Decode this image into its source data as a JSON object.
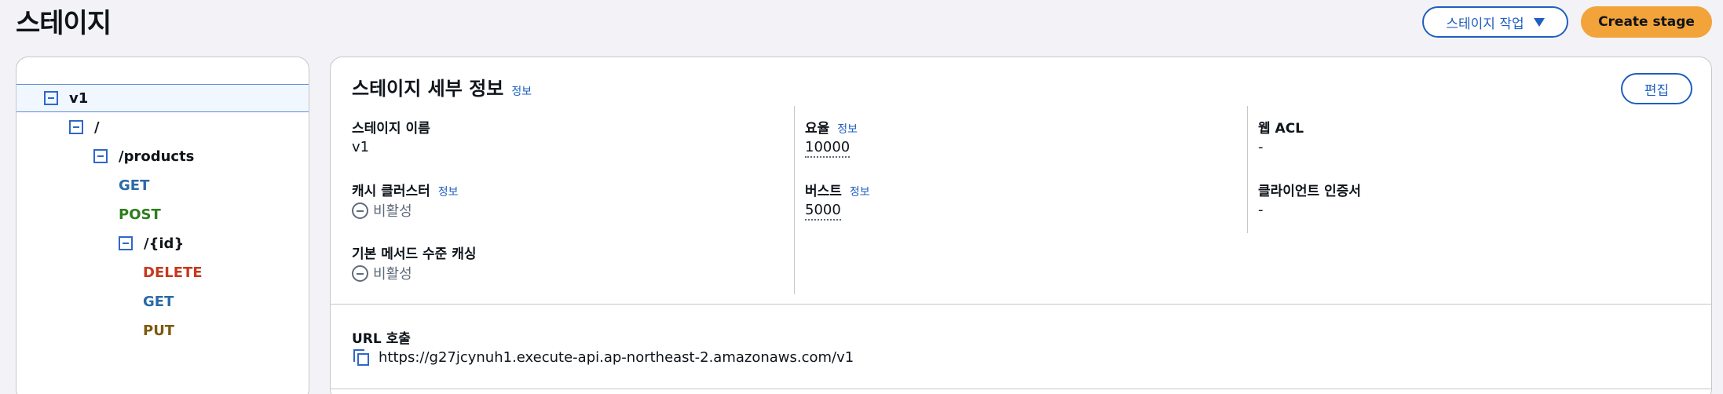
{
  "header": {
    "title": "스테이지",
    "actions_label": "스테이지 작업",
    "create_label": "Create stage"
  },
  "tree": [
    {
      "label": "v1",
      "kind": "resource",
      "selected": true
    },
    {
      "label": "/",
      "kind": "resource"
    },
    {
      "label": "/products",
      "kind": "resource"
    },
    {
      "label": "GET",
      "kind": "method"
    },
    {
      "label": "POST",
      "kind": "method"
    },
    {
      "label": "/{id}",
      "kind": "resource"
    },
    {
      "label": "DELETE",
      "kind": "method"
    },
    {
      "label": "GET",
      "kind": "method"
    },
    {
      "label": "PUT",
      "kind": "method"
    }
  ],
  "details": {
    "title": "스테이지 세부 정보",
    "info": "정보",
    "edit_label": "편집",
    "stage_name_label": "스테이지 이름",
    "stage_name_value": "v1",
    "cache_cluster_label": "캐시 클러스터",
    "cache_cluster_value": "비활성",
    "method_cache_label": "기본 메서드 수준 캐싱",
    "method_cache_value": "비활성",
    "rate_label": "요율",
    "rate_value": "10000",
    "burst_label": "버스트",
    "burst_value": "5000",
    "waf_label": "웹 ACL",
    "waf_value": "-",
    "client_cert_label": "클라이언트 인증서",
    "client_cert_value": "-",
    "invoke_url_label": "URL 호출",
    "invoke_url_value": "https://g27jcynuh1.execute-api.ap-northeast-2.amazonaws.com/v1"
  },
  "colors": {
    "accent": "#1f5fbf",
    "primary_button": "#f2a33a",
    "method_get": "#2a6aa8",
    "method_post": "#2d7d1c",
    "method_delete": "#c43a1e",
    "method_put": "#7b5a0d"
  }
}
